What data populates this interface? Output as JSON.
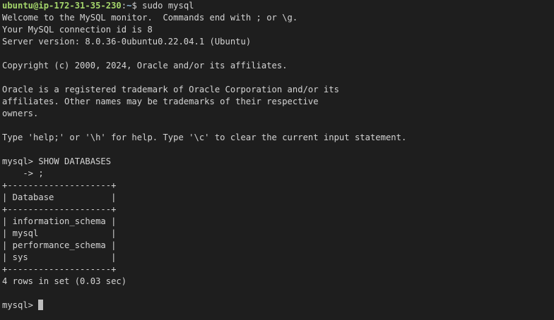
{
  "shell_prompt": {
    "user_host": "ubuntu@ip-172-31-35-230",
    "separator": ":",
    "path": "~",
    "symbol": "$ ",
    "command": "sudo mysql"
  },
  "banner": {
    "welcome": "Welcome to the MySQL monitor.  Commands end with ; or \\g.",
    "connection_id": "Your MySQL connection id is 8",
    "server_version": "Server version: 8.0.36-0ubuntu0.22.04.1 (Ubuntu)",
    "copyright": "Copyright (c) 2000, 2024, Oracle and/or its affiliates.",
    "trademark_1": "Oracle is a registered trademark of Oracle Corporation and/or its",
    "trademark_2": "affiliates. Other names may be trademarks of their respective",
    "trademark_3": "owners.",
    "help_hint": "Type 'help;' or '\\h' for help. Type '\\c' to clear the current input statement."
  },
  "query": {
    "line_1": "mysql> SHOW DATABASES",
    "line_2": "    -> ;"
  },
  "result_table": {
    "border": "+--------------------+",
    "header": "| Database           |",
    "rows": [
      "| information_schema |",
      "| mysql              |",
      "| performance_schema |",
      "| sys                |"
    ],
    "summary": "4 rows in set (0.03 sec)"
  },
  "current_prompt": "mysql> ",
  "colors": {
    "background": "#1e1e1e",
    "text": "#d4d4d4",
    "prompt_user": "#a5d66b",
    "prompt_path": "#8eb6d9",
    "cursor": "#bdbdbd"
  }
}
